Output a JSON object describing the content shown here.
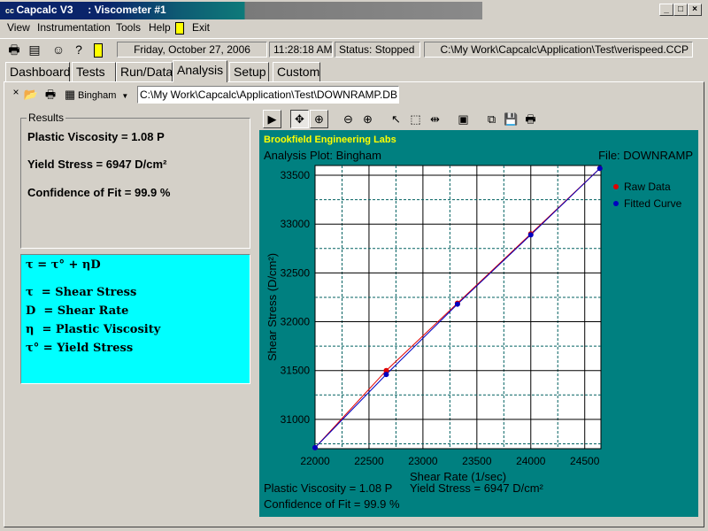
{
  "window": {
    "title": "Capcalc V3",
    "subtitle": ": Viscometer #1"
  },
  "menu": [
    "View",
    "Instrumentation",
    "Tools",
    "Help",
    "Exit"
  ],
  "status": {
    "date": "Friday, October 27, 2006",
    "time": "11:28:18 AM",
    "state": "Status: Stopped",
    "path": "C:\\My Work\\Capcalc\\Application\\Test\\verispeed.CCP"
  },
  "tabs": [
    "Dashboard",
    "Tests",
    "Run/Data",
    "Analysis",
    "Setup",
    "Custom"
  ],
  "analysis": {
    "model": "Bingham",
    "file_path": "C:\\My Work\\Capcalc\\Application\\Test\\DOWNRAMP.DB",
    "results_label": "Results",
    "plastic_viscosity": "Plastic Viscosity = 1.08 P",
    "yield_stress": "Yield Stress = 6947 D/cm²",
    "confidence": "Confidence of Fit = 99.9 %",
    "equation": "τ = τ° + ηD",
    "legend": [
      "τ  = Shear Stress",
      "D  = Shear Rate",
      "η  = Plastic Viscosity",
      "τ° = Yield Stress"
    ]
  },
  "chart_data": {
    "type": "scatter",
    "company": "Brookfield Engineering Labs",
    "title": "Analysis Plot: Bingham",
    "file": "File: DOWNRAMP",
    "xlabel": "Shear Rate (1/sec)",
    "ylabel": "Shear Stress (D/cm²)",
    "xlim": [
      22000,
      24650
    ],
    "ylim": [
      30700,
      33600
    ],
    "xticks": [
      22000,
      22500,
      23000,
      23500,
      24000,
      24500
    ],
    "yticks": [
      31000,
      31500,
      32000,
      32500,
      33000,
      33500
    ],
    "series": [
      {
        "name": "Raw Data",
        "color": "#e00000",
        "x": [
          22000,
          22660,
          23320,
          24000,
          24640
        ],
        "y": [
          30710,
          31500,
          32190,
          32900,
          33570
        ]
      },
      {
        "name": "Fitted Curve",
        "color": "#0000c0",
        "x": [
          22000,
          22660,
          23320,
          24000,
          24640
        ],
        "y": [
          30710,
          31460,
          32180,
          32890,
          33570
        ]
      }
    ],
    "grid": true,
    "legend_position": "right",
    "footer": {
      "plastic_viscosity": "Plastic Viscosity = 1.08 P",
      "yield_stress": "Yield Stress = 6947 D/cm²",
      "confidence": "Confidence of Fit = 99.9 %"
    }
  }
}
